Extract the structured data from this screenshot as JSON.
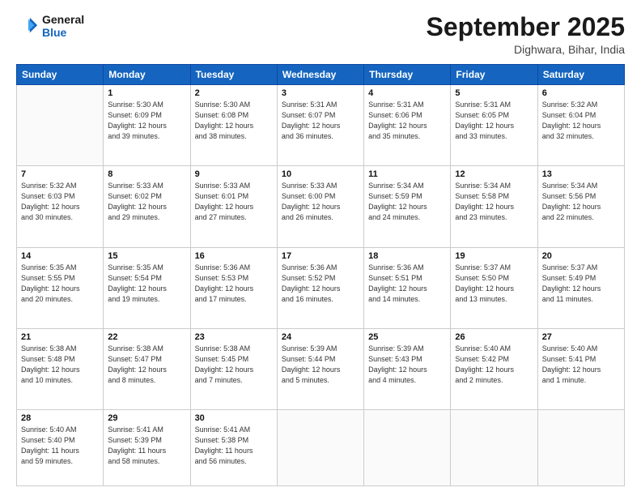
{
  "logo": {
    "line1": "General",
    "line2": "Blue"
  },
  "header": {
    "title": "September 2025",
    "location": "Dighwara, Bihar, India"
  },
  "weekdays": [
    "Sunday",
    "Monday",
    "Tuesday",
    "Wednesday",
    "Thursday",
    "Friday",
    "Saturday"
  ],
  "weeks": [
    [
      {
        "num": "",
        "text": ""
      },
      {
        "num": "1",
        "text": "Sunrise: 5:30 AM\nSunset: 6:09 PM\nDaylight: 12 hours\nand 39 minutes."
      },
      {
        "num": "2",
        "text": "Sunrise: 5:30 AM\nSunset: 6:08 PM\nDaylight: 12 hours\nand 38 minutes."
      },
      {
        "num": "3",
        "text": "Sunrise: 5:31 AM\nSunset: 6:07 PM\nDaylight: 12 hours\nand 36 minutes."
      },
      {
        "num": "4",
        "text": "Sunrise: 5:31 AM\nSunset: 6:06 PM\nDaylight: 12 hours\nand 35 minutes."
      },
      {
        "num": "5",
        "text": "Sunrise: 5:31 AM\nSunset: 6:05 PM\nDaylight: 12 hours\nand 33 minutes."
      },
      {
        "num": "6",
        "text": "Sunrise: 5:32 AM\nSunset: 6:04 PM\nDaylight: 12 hours\nand 32 minutes."
      }
    ],
    [
      {
        "num": "7",
        "text": "Sunrise: 5:32 AM\nSunset: 6:03 PM\nDaylight: 12 hours\nand 30 minutes."
      },
      {
        "num": "8",
        "text": "Sunrise: 5:33 AM\nSunset: 6:02 PM\nDaylight: 12 hours\nand 29 minutes."
      },
      {
        "num": "9",
        "text": "Sunrise: 5:33 AM\nSunset: 6:01 PM\nDaylight: 12 hours\nand 27 minutes."
      },
      {
        "num": "10",
        "text": "Sunrise: 5:33 AM\nSunset: 6:00 PM\nDaylight: 12 hours\nand 26 minutes."
      },
      {
        "num": "11",
        "text": "Sunrise: 5:34 AM\nSunset: 5:59 PM\nDaylight: 12 hours\nand 24 minutes."
      },
      {
        "num": "12",
        "text": "Sunrise: 5:34 AM\nSunset: 5:58 PM\nDaylight: 12 hours\nand 23 minutes."
      },
      {
        "num": "13",
        "text": "Sunrise: 5:34 AM\nSunset: 5:56 PM\nDaylight: 12 hours\nand 22 minutes."
      }
    ],
    [
      {
        "num": "14",
        "text": "Sunrise: 5:35 AM\nSunset: 5:55 PM\nDaylight: 12 hours\nand 20 minutes."
      },
      {
        "num": "15",
        "text": "Sunrise: 5:35 AM\nSunset: 5:54 PM\nDaylight: 12 hours\nand 19 minutes."
      },
      {
        "num": "16",
        "text": "Sunrise: 5:36 AM\nSunset: 5:53 PM\nDaylight: 12 hours\nand 17 minutes."
      },
      {
        "num": "17",
        "text": "Sunrise: 5:36 AM\nSunset: 5:52 PM\nDaylight: 12 hours\nand 16 minutes."
      },
      {
        "num": "18",
        "text": "Sunrise: 5:36 AM\nSunset: 5:51 PM\nDaylight: 12 hours\nand 14 minutes."
      },
      {
        "num": "19",
        "text": "Sunrise: 5:37 AM\nSunset: 5:50 PM\nDaylight: 12 hours\nand 13 minutes."
      },
      {
        "num": "20",
        "text": "Sunrise: 5:37 AM\nSunset: 5:49 PM\nDaylight: 12 hours\nand 11 minutes."
      }
    ],
    [
      {
        "num": "21",
        "text": "Sunrise: 5:38 AM\nSunset: 5:48 PM\nDaylight: 12 hours\nand 10 minutes."
      },
      {
        "num": "22",
        "text": "Sunrise: 5:38 AM\nSunset: 5:47 PM\nDaylight: 12 hours\nand 8 minutes."
      },
      {
        "num": "23",
        "text": "Sunrise: 5:38 AM\nSunset: 5:45 PM\nDaylight: 12 hours\nand 7 minutes."
      },
      {
        "num": "24",
        "text": "Sunrise: 5:39 AM\nSunset: 5:44 PM\nDaylight: 12 hours\nand 5 minutes."
      },
      {
        "num": "25",
        "text": "Sunrise: 5:39 AM\nSunset: 5:43 PM\nDaylight: 12 hours\nand 4 minutes."
      },
      {
        "num": "26",
        "text": "Sunrise: 5:40 AM\nSunset: 5:42 PM\nDaylight: 12 hours\nand 2 minutes."
      },
      {
        "num": "27",
        "text": "Sunrise: 5:40 AM\nSunset: 5:41 PM\nDaylight: 12 hours\nand 1 minute."
      }
    ],
    [
      {
        "num": "28",
        "text": "Sunrise: 5:40 AM\nSunset: 5:40 PM\nDaylight: 11 hours\nand 59 minutes."
      },
      {
        "num": "29",
        "text": "Sunrise: 5:41 AM\nSunset: 5:39 PM\nDaylight: 11 hours\nand 58 minutes."
      },
      {
        "num": "30",
        "text": "Sunrise: 5:41 AM\nSunset: 5:38 PM\nDaylight: 11 hours\nand 56 minutes."
      },
      {
        "num": "",
        "text": ""
      },
      {
        "num": "",
        "text": ""
      },
      {
        "num": "",
        "text": ""
      },
      {
        "num": "",
        "text": ""
      }
    ]
  ]
}
